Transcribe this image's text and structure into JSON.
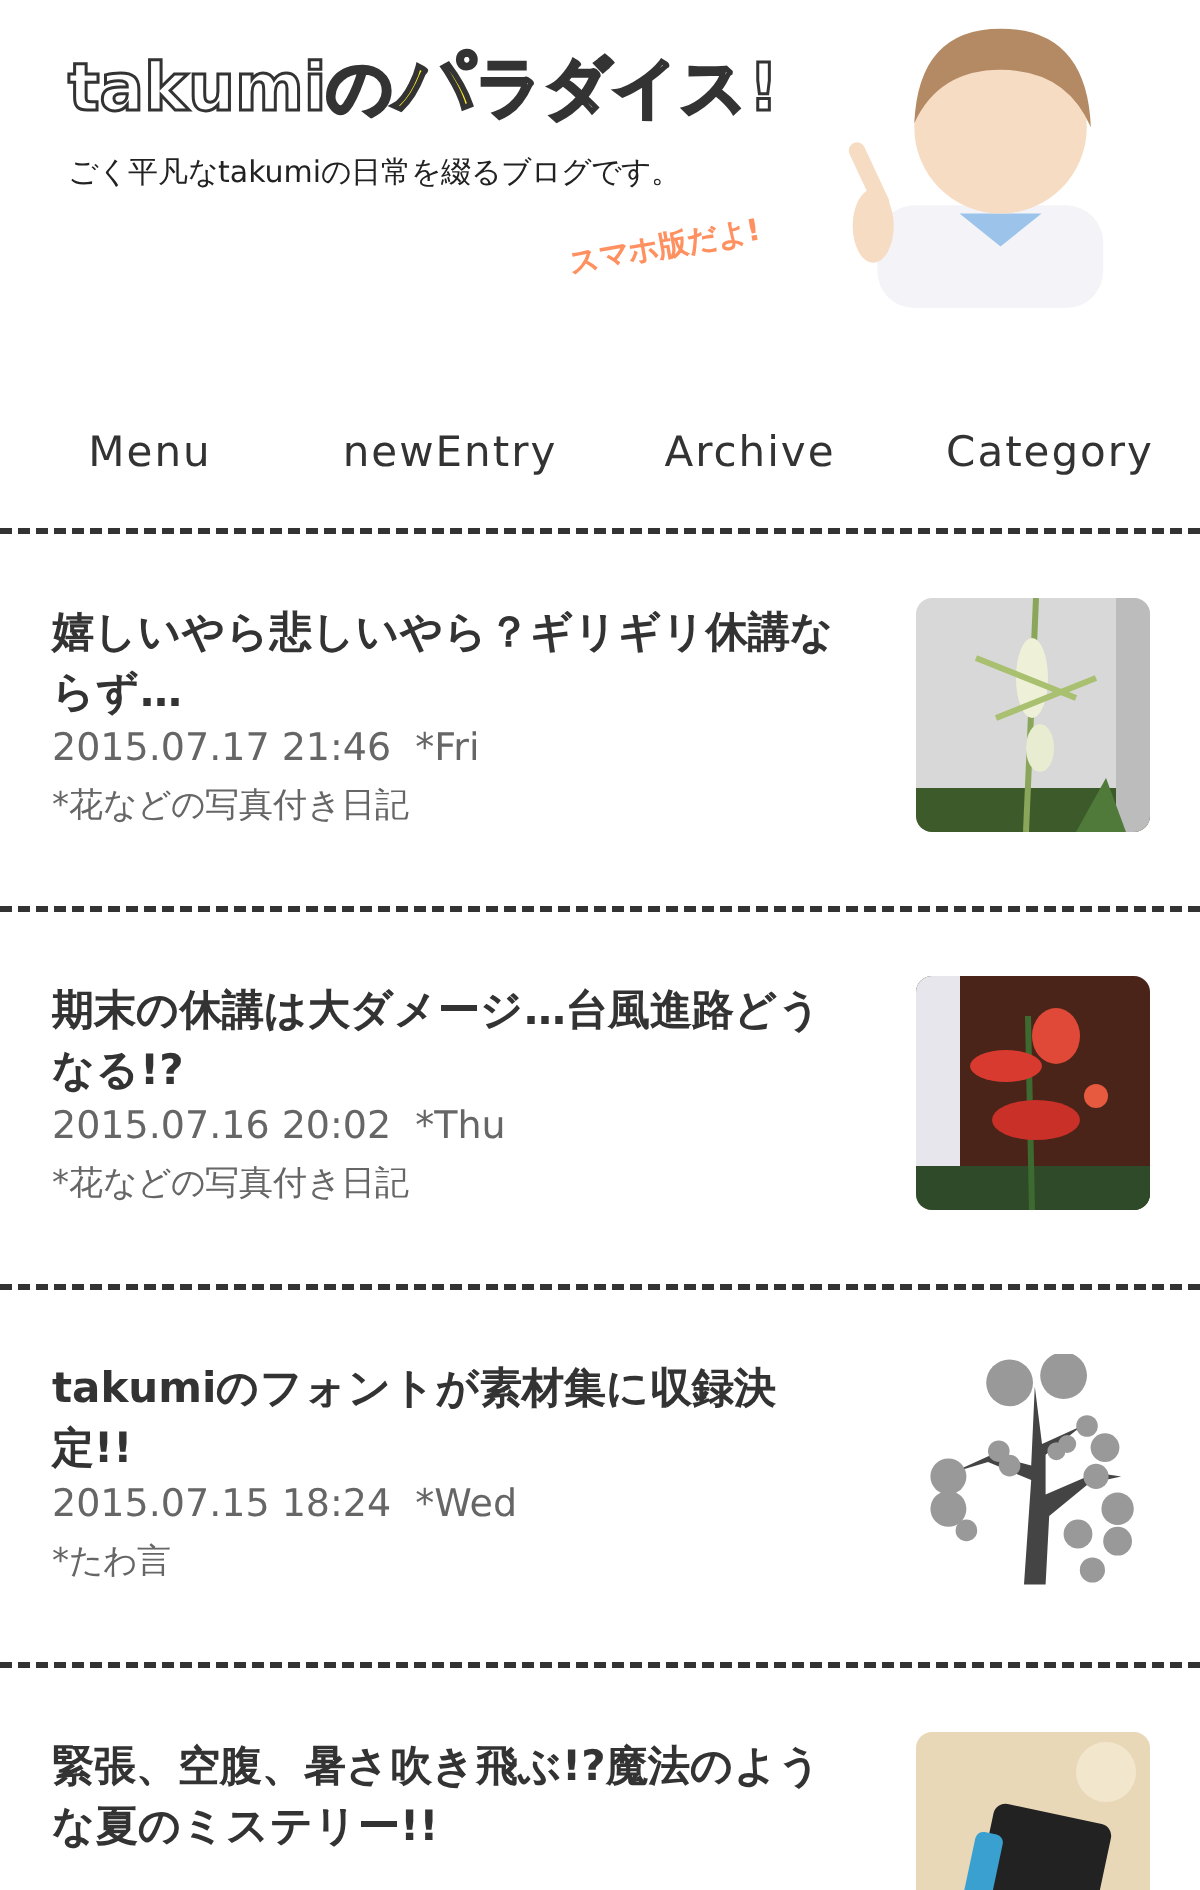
{
  "header": {
    "logo": [
      {
        "text": "takumiの",
        "highlight": false
      },
      {
        "text": "パ",
        "highlight": true
      },
      {
        "text": "ラダイス!",
        "highlight": false
      }
    ],
    "tagline": "ごく平凡なtakumiの日常を綴るブログです。",
    "badge": "スマホ版だよ!"
  },
  "nav": [
    {
      "label": "Menu"
    },
    {
      "label": "newEntry"
    },
    {
      "label": "Archive"
    },
    {
      "label": "Category"
    }
  ],
  "entries": [
    {
      "title": "嬉しいやら悲しいやら？ギリギリ休講ならず…",
      "date": "2015.07.17 21:46",
      "weekday": "*Fri",
      "category": "*花などの写真付き日記"
    },
    {
      "title": "期末の休講は大ダメージ…台風進路どうなる!?",
      "date": "2015.07.16 20:02",
      "weekday": "*Thu",
      "category": "*花などの写真付き日記"
    },
    {
      "title": "takumiのフォントが素材集に収録決定!!",
      "date": "2015.07.15 18:24",
      "weekday": "*Wed",
      "category": "*たわ言",
      "thumb": {
        "kind": "tree"
      }
    },
    {
      "title": "緊張、空腹、暑さ吹き飛ぶ!?魔法のような夏のミステリー!!"
    }
  ]
}
